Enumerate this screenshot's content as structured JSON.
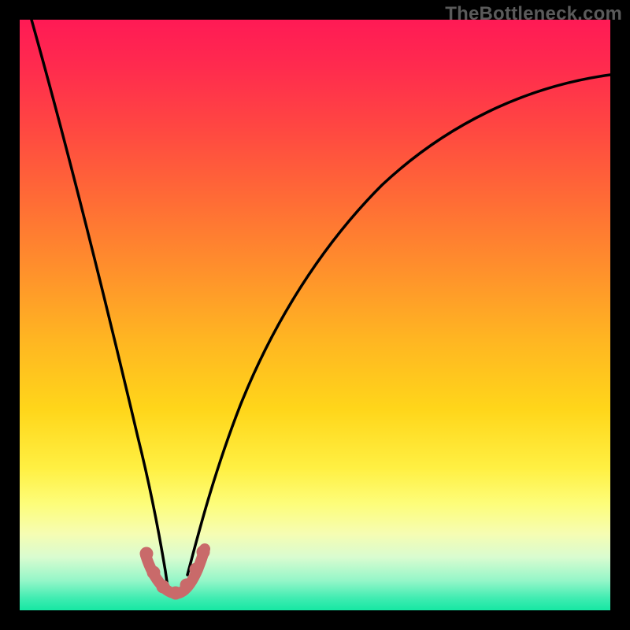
{
  "watermark": {
    "text": "TheBottleneck.com"
  },
  "chart_data": {
    "type": "line",
    "title": "",
    "xlabel": "",
    "ylabel": "",
    "xlim": [
      0,
      100
    ],
    "ylim": [
      0,
      100
    ],
    "grid": false,
    "legend": false,
    "series": [
      {
        "name": "bottleneck-curve",
        "x": [
          2,
          5,
          8,
          11,
          14,
          17,
          20,
          21.5,
          23,
          24,
          25,
          26,
          27,
          28.5,
          30,
          33,
          37,
          42,
          48,
          55,
          63,
          72,
          82,
          92,
          100
        ],
        "y": [
          100,
          87,
          74,
          62,
          50,
          38,
          26,
          18,
          11,
          7,
          5,
          5,
          7,
          12,
          20,
          34,
          47,
          58,
          67,
          74,
          79,
          83,
          86,
          88,
          90
        ]
      },
      {
        "name": "marker-base",
        "x": [
          21.5,
          22.3,
          23.2,
          24.0,
          25.0,
          26.0,
          27.0,
          27.8,
          28.5
        ],
        "y": [
          9.5,
          7.5,
          6.1,
          5.2,
          4.8,
          5.2,
          6.3,
          8.0,
          10.0
        ]
      }
    ],
    "colors": {
      "curve": "#000000",
      "marker": "#cc6666",
      "gradient_top": "#ff1a55",
      "gradient_bottom": "#16e7a3"
    }
  }
}
